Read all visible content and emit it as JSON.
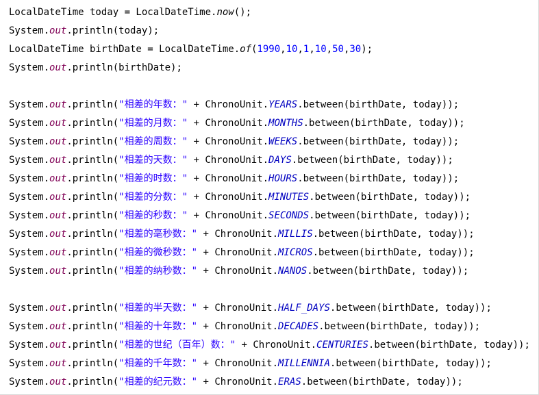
{
  "code_lines": [
    {
      "tokens": [
        {
          "t": "LocalDateTime today = LocalDateTime."
        },
        {
          "t": "now",
          "k": "static"
        },
        {
          "t": "();"
        }
      ]
    },
    {
      "tokens": [
        {
          "t": "System."
        },
        {
          "t": "out",
          "k": "field"
        },
        {
          "t": ".println(today);"
        }
      ]
    },
    {
      "tokens": [
        {
          "t": "LocalDateTime birthDate = LocalDateTime."
        },
        {
          "t": "of",
          "k": "static"
        },
        {
          "t": "("
        },
        {
          "t": "1990",
          "k": "num"
        },
        {
          "t": ","
        },
        {
          "t": "10",
          "k": "num"
        },
        {
          "t": ","
        },
        {
          "t": "1",
          "k": "num"
        },
        {
          "t": ","
        },
        {
          "t": "10",
          "k": "num"
        },
        {
          "t": ","
        },
        {
          "t": "50",
          "k": "num"
        },
        {
          "t": ","
        },
        {
          "t": "30",
          "k": "num"
        },
        {
          "t": ");"
        }
      ]
    },
    {
      "tokens": [
        {
          "t": "System."
        },
        {
          "t": "out",
          "k": "field"
        },
        {
          "t": ".println(birthDate);"
        }
      ]
    },
    {
      "tokens": []
    },
    {
      "tokens": [
        {
          "t": "System."
        },
        {
          "t": "out",
          "k": "field"
        },
        {
          "t": ".println("
        },
        {
          "t": "\"相差的年数：\"",
          "k": "str"
        },
        {
          "t": " + ChronoUnit."
        },
        {
          "t": "YEARS",
          "k": "const"
        },
        {
          "t": ".between(birthDate, today));"
        }
      ]
    },
    {
      "tokens": [
        {
          "t": "System."
        },
        {
          "t": "out",
          "k": "field"
        },
        {
          "t": ".println("
        },
        {
          "t": "\"相差的月数：\"",
          "k": "str"
        },
        {
          "t": " + ChronoUnit."
        },
        {
          "t": "MONTHS",
          "k": "const"
        },
        {
          "t": ".between(birthDate, today));"
        }
      ]
    },
    {
      "tokens": [
        {
          "t": "System."
        },
        {
          "t": "out",
          "k": "field"
        },
        {
          "t": ".println("
        },
        {
          "t": "\"相差的周数：\"",
          "k": "str"
        },
        {
          "t": " + ChronoUnit."
        },
        {
          "t": "WEEKS",
          "k": "const"
        },
        {
          "t": ".between(birthDate, today));"
        }
      ]
    },
    {
      "tokens": [
        {
          "t": "System."
        },
        {
          "t": "out",
          "k": "field"
        },
        {
          "t": ".println("
        },
        {
          "t": "\"相差的天数：\"",
          "k": "str"
        },
        {
          "t": " + ChronoUnit."
        },
        {
          "t": "DAYS",
          "k": "const"
        },
        {
          "t": ".between(birthDate, today));"
        }
      ]
    },
    {
      "tokens": [
        {
          "t": "System."
        },
        {
          "t": "out",
          "k": "field"
        },
        {
          "t": ".println("
        },
        {
          "t": "\"相差的时数：\"",
          "k": "str"
        },
        {
          "t": " + ChronoUnit."
        },
        {
          "t": "HOURS",
          "k": "const"
        },
        {
          "t": ".between(birthDate, today));"
        }
      ]
    },
    {
      "tokens": [
        {
          "t": "System."
        },
        {
          "t": "out",
          "k": "field"
        },
        {
          "t": ".println("
        },
        {
          "t": "\"相差的分数：\"",
          "k": "str"
        },
        {
          "t": " + ChronoUnit."
        },
        {
          "t": "MINUTES",
          "k": "const"
        },
        {
          "t": ".between(birthDate, today));"
        }
      ]
    },
    {
      "tokens": [
        {
          "t": "System."
        },
        {
          "t": "out",
          "k": "field"
        },
        {
          "t": ".println("
        },
        {
          "t": "\"相差的秒数：\"",
          "k": "str"
        },
        {
          "t": " + ChronoUnit."
        },
        {
          "t": "SECONDS",
          "k": "const"
        },
        {
          "t": ".between(birthDate, today));"
        }
      ]
    },
    {
      "tokens": [
        {
          "t": "System."
        },
        {
          "t": "out",
          "k": "field"
        },
        {
          "t": ".println("
        },
        {
          "t": "\"相差的毫秒数：\"",
          "k": "str"
        },
        {
          "t": " + ChronoUnit."
        },
        {
          "t": "MILLIS",
          "k": "const"
        },
        {
          "t": ".between(birthDate, today));"
        }
      ]
    },
    {
      "tokens": [
        {
          "t": "System."
        },
        {
          "t": "out",
          "k": "field"
        },
        {
          "t": ".println("
        },
        {
          "t": "\"相差的微秒数：\"",
          "k": "str"
        },
        {
          "t": " + ChronoUnit."
        },
        {
          "t": "MICROS",
          "k": "const"
        },
        {
          "t": ".between(birthDate, today));"
        }
      ]
    },
    {
      "tokens": [
        {
          "t": "System."
        },
        {
          "t": "out",
          "k": "field"
        },
        {
          "t": ".println("
        },
        {
          "t": "\"相差的纳秒数：\"",
          "k": "str"
        },
        {
          "t": " + ChronoUnit."
        },
        {
          "t": "NANOS",
          "k": "const"
        },
        {
          "t": ".between(birthDate, today));"
        }
      ]
    },
    {
      "tokens": []
    },
    {
      "tokens": [
        {
          "t": "System."
        },
        {
          "t": "out",
          "k": "field"
        },
        {
          "t": ".println("
        },
        {
          "t": "\"相差的半天数：\"",
          "k": "str"
        },
        {
          "t": " + ChronoUnit."
        },
        {
          "t": "HALF_DAYS",
          "k": "const"
        },
        {
          "t": ".between(birthDate, today));"
        }
      ]
    },
    {
      "tokens": [
        {
          "t": "System."
        },
        {
          "t": "out",
          "k": "field"
        },
        {
          "t": ".println("
        },
        {
          "t": "\"相差的十年数：\"",
          "k": "str"
        },
        {
          "t": " + ChronoUnit."
        },
        {
          "t": "DECADES",
          "k": "const"
        },
        {
          "t": ".between(birthDate, today));"
        }
      ]
    },
    {
      "tokens": [
        {
          "t": "System."
        },
        {
          "t": "out",
          "k": "field"
        },
        {
          "t": ".println("
        },
        {
          "t": "\"相差的世纪（百年）数：\"",
          "k": "str"
        },
        {
          "t": " + ChronoUnit."
        },
        {
          "t": "CENTURIES",
          "k": "const"
        },
        {
          "t": ".between(birthDate, today));"
        }
      ]
    },
    {
      "tokens": [
        {
          "t": "System."
        },
        {
          "t": "out",
          "k": "field"
        },
        {
          "t": ".println("
        },
        {
          "t": "\"相差的千年数：\"",
          "k": "str"
        },
        {
          "t": " + ChronoUnit."
        },
        {
          "t": "MILLENNIA",
          "k": "const"
        },
        {
          "t": ".between(birthDate, today));"
        }
      ]
    },
    {
      "tokens": [
        {
          "t": "System."
        },
        {
          "t": "out",
          "k": "field"
        },
        {
          "t": ".println("
        },
        {
          "t": "\"相差的纪元数：\"",
          "k": "str"
        },
        {
          "t": " + ChronoUnit."
        },
        {
          "t": "ERAS",
          "k": "const"
        },
        {
          "t": ".between(birthDate, today));"
        }
      ]
    }
  ]
}
